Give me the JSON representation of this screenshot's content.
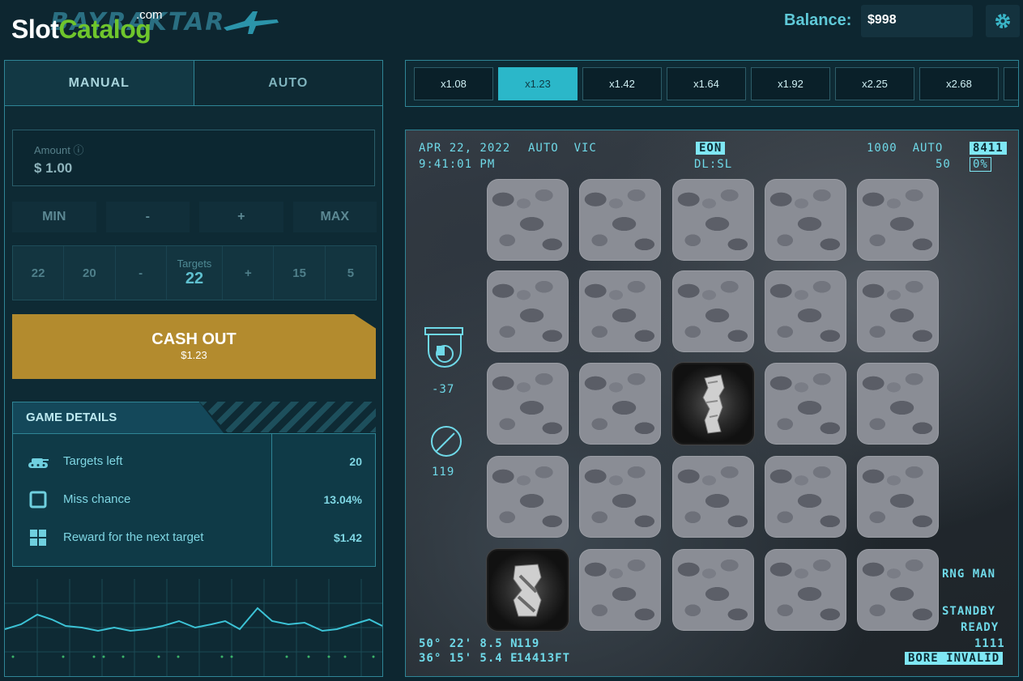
{
  "header": {
    "logo_slot": "Slot",
    "logo_catalog": "Catalog",
    "logo_dotcom": ".com",
    "logo_game": "BAYRAKTAR",
    "balance_label": "Balance:",
    "balance_value": "$998",
    "settings_icon": "gear-icon"
  },
  "tabs": [
    {
      "label": "MANUAL",
      "active": true
    },
    {
      "label": "AUTO",
      "active": false
    }
  ],
  "amount": {
    "label": "Amount ⓘ",
    "value": "$ 1.00"
  },
  "bet_buttons": [
    "MIN",
    "-",
    "+",
    "MAX"
  ],
  "targets": {
    "left_values": [
      "22",
      "20",
      "-"
    ],
    "label": "Targets",
    "value": "22",
    "right_values": [
      "+",
      "15",
      "5"
    ]
  },
  "cashout": {
    "label": "CASH OUT",
    "amount": "$1.23",
    "color": "#b38b2e"
  },
  "game_details": {
    "title": "GAME DETAILS",
    "rows": [
      {
        "icon": "tank-icon",
        "label": "Targets left",
        "value": "20"
      },
      {
        "icon": "square-icon",
        "label": "Miss chance",
        "value": "13.04%"
      },
      {
        "icon": "grid-icon",
        "label": "Reward for the next target",
        "value": "$1.42"
      }
    ]
  },
  "multipliers": [
    {
      "label": "x1.08",
      "active": false
    },
    {
      "label": "x1.23",
      "active": true
    },
    {
      "label": "x1.42",
      "active": false
    },
    {
      "label": "x1.64",
      "active": false
    },
    {
      "label": "x1.92",
      "active": false
    },
    {
      "label": "x2.25",
      "active": false
    },
    {
      "label": "x2.68",
      "active": false
    }
  ],
  "hud": {
    "date": "APR 22, 2022",
    "time": "9:41:01 PM",
    "mode": "AUTO  VIC",
    "eon": "EON",
    "dlsl": "DL:SL",
    "right_top": "1000  AUTO",
    "right_mid": "50",
    "box_top": "8411",
    "box_bottom": "0%",
    "gauge1_value": "-37",
    "gauge2_value": "119",
    "coord_lat": "50° 22' 8.5 N",
    "coord_lon": "36° 15' 5.4 E",
    "alt_a": "119",
    "alt_b": "14413FT",
    "rng": "RNG MAN",
    "standby": "STANDBY",
    "ready": "READY",
    "code": "1111",
    "bore": "BORE INVALID"
  },
  "board": {
    "rows": 5,
    "cols": 5,
    "revealed": [
      {
        "row": 2,
        "col": 2,
        "state": "hit"
      },
      {
        "row": 4,
        "col": 0,
        "state": "hit"
      }
    ]
  },
  "colors": {
    "accent": "#2bb7c9",
    "panel_border": "#2f8596",
    "background": "#0d2630",
    "hud_text": "#6fd9e8"
  }
}
